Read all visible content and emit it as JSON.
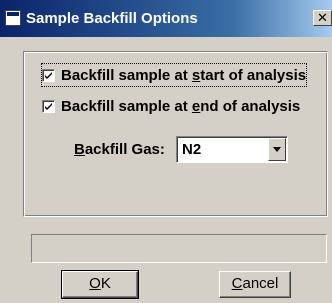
{
  "window": {
    "title": "Sample Backfill Options",
    "close_glyph": "✕"
  },
  "options": {
    "backfill_start": {
      "pre": "Backfill sample at ",
      "accel": "s",
      "post": "tart of analysis",
      "checked": true
    },
    "backfill_end": {
      "pre": "Backfill sample at ",
      "accel": "e",
      "post": "nd of analysis",
      "checked": true
    }
  },
  "gas": {
    "label_accel": "B",
    "label_rest": "ackfill Gas:",
    "value": "N2"
  },
  "status": {
    "text": ""
  },
  "buttons": {
    "ok": {
      "accel": "O",
      "rest": "K"
    },
    "cancel": {
      "accel": "C",
      "rest": "ancel"
    }
  },
  "icons": {
    "window": "window-icon",
    "close": "close-icon",
    "check": "checkmark-icon",
    "dropdown": "chevron-down-icon"
  }
}
